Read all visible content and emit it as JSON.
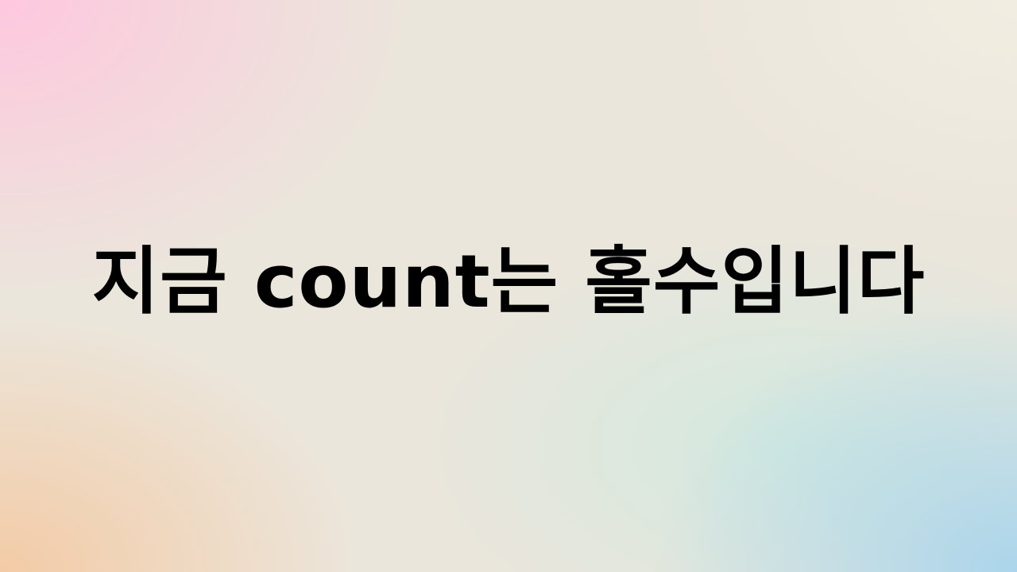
{
  "message": {
    "text": "지금 count는 홀수입니다"
  },
  "colors": {
    "text": "#000000",
    "gradient_top_left": "#ffc6de",
    "gradient_bottom_left": "#f4c8a0",
    "gradient_bottom_right": "#a8d4ec",
    "gradient_center": "#ebe6dc"
  }
}
